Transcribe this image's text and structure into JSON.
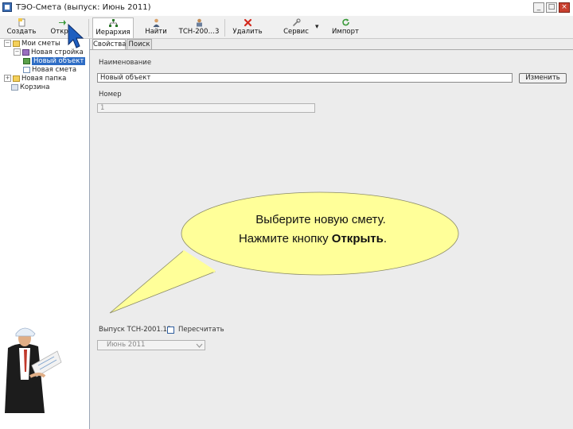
{
  "window": {
    "title": "ТЭО-Смета (выпуск: Июнь 2011)",
    "controls": [
      "_",
      "□",
      "×"
    ]
  },
  "toolbar": {
    "buttons": [
      {
        "label": "Создать",
        "icon": "create-document-icon"
      },
      {
        "label": "Откры",
        "icon": "open-arrow-icon"
      },
      {
        "label": "Иерархия",
        "icon": "hierarchy-icon",
        "active": true
      },
      {
        "label": "Найти",
        "icon": "find-person-icon"
      },
      {
        "label": "ТСН-200…3",
        "icon": "tsn-catalog-icon"
      },
      {
        "label": "Удалить",
        "icon": "delete-x-icon"
      },
      {
        "label": "Сервис",
        "icon": "service-wrench-icon"
      },
      {
        "label": "Импорт",
        "icon": "import-refresh-icon"
      }
    ],
    "dropdown_glyph": "▾"
  },
  "tree": {
    "items": [
      {
        "label": "Мои сметы",
        "toggle": "−",
        "icon": "folder"
      },
      {
        "label": "Новая стройка",
        "toggle": "−",
        "icon": "building"
      },
      {
        "label": "Новый объект",
        "icon": "object",
        "selected": true
      },
      {
        "label": "Новая смета",
        "icon": "doc"
      },
      {
        "label": "Новая папка",
        "toggle": "+",
        "icon": "folder"
      },
      {
        "label": "Корзина",
        "icon": "bin"
      }
    ]
  },
  "tabs": [
    {
      "label": "Свойства",
      "active": true
    },
    {
      "label": "Поиск",
      "active": false
    }
  ],
  "form": {
    "name_label": "Наименование",
    "name_value": "Новый объект",
    "change_button": "Изменить",
    "number_label": "Номер",
    "number_value": "1",
    "release_label": "Выпуск ТСН-2001.13",
    "recalc_label": "Пересчитать",
    "release_value": "Июнь 2011"
  },
  "callout": {
    "line1": "Выберите новую смету.",
    "line2_prefix": "Нажмите кнопку ",
    "line2_bold": "Открыть",
    "line2_suffix": "."
  },
  "colors": {
    "bubble_fill": "#ffff99",
    "selection": "#2e6dc5",
    "close_button": "#c9402f",
    "cursor": "#1f5fc0"
  }
}
